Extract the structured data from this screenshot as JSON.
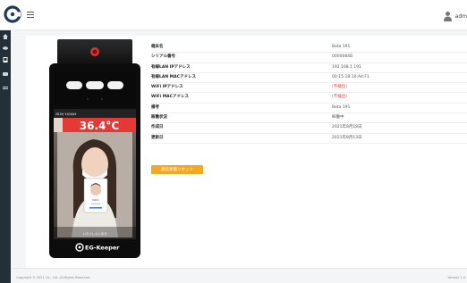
{
  "header": {
    "user_name": "adm"
  },
  "device_screen": {
    "datetime": "2019/ 10/4/04",
    "temperature": "36.4°C",
    "welcome_text": "いらっしゃいませ",
    "brand": "EG-Keeper",
    "card_line1": "Patrick",
    "card_line2": "00000000"
  },
  "info": [
    {
      "key": "端末名",
      "value": "Beta 191",
      "alert": false
    },
    {
      "key": "シリアル番号",
      "value": "0000084B",
      "alert": false
    },
    {
      "key": "有線LAN IPアドレス",
      "value": "192.168.1.191",
      "alert": false
    },
    {
      "key": "有線LAN MACアドレス",
      "value": "00:15:18:10:A4:F1",
      "alert": false
    },
    {
      "key": "WiFi IPアドレス",
      "value": "(不検出)",
      "alert": true
    },
    {
      "key": "WiFi MACアドレス",
      "value": "(不検出)",
      "alert": true
    },
    {
      "key": "備考",
      "value": "Beta 191",
      "alert": false
    },
    {
      "key": "稼働状況",
      "value": "稼働中",
      "alert": false
    },
    {
      "key": "作成日",
      "value": "2021年8月18日",
      "alert": false
    },
    {
      "key": "更新日",
      "value": "2021年8月13日",
      "alert": false
    }
  ],
  "actions": {
    "reset_label": "通信状態リセット"
  },
  "footer": {
    "copyright": "Copyright © 2021 Co., Ltd. All Rights Reserved.",
    "version": "Version 1.0"
  },
  "colors": {
    "sidebar": "#23303a",
    "accent": "#f5a623",
    "alert": "#e53935",
    "temperature": "#e53935"
  }
}
